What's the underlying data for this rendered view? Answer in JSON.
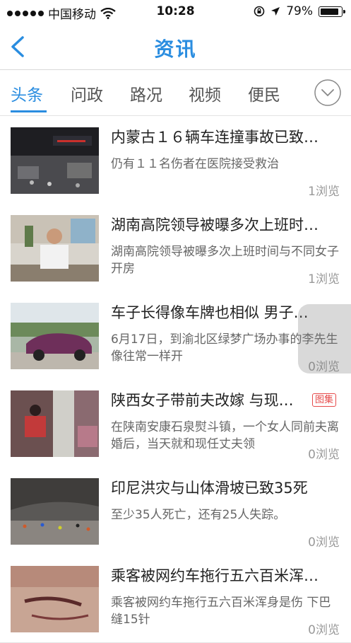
{
  "status": {
    "carrier": "中国移动",
    "time": "10:28",
    "battery": "79%"
  },
  "nav": {
    "title": "资讯"
  },
  "tabs": [
    "头条",
    "问政",
    "路况",
    "视频",
    "便民"
  ],
  "articles": [
    {
      "title": "内蒙古１６辆车连撞事故已致…",
      "summary": "仍有１１名伤者在医院接受救治",
      "views": "1浏览"
    },
    {
      "title": "湖南高院领导被曝多次上班时…",
      "summary": "湖南高院领导被曝多次上班时间与不同女子开房",
      "views": "1浏览"
    },
    {
      "title": "车子长得像车牌也相似 男子…",
      "summary": "6月17日，到渝北区绿梦广场办事的李先生像往常一样开",
      "views": "0浏览"
    },
    {
      "title": "陕西女子带前夫改嫁 与现…",
      "summary": "在陕南安康石泉熨斗镇，一个女人同前夫离婚后，当天就和现任丈夫领",
      "views": "0浏览",
      "tag": "图集"
    },
    {
      "title": "印尼洪灾与山体滑坡已致35死",
      "summary": "至少35人死亡，还有25人失踪。",
      "views": "0浏览"
    },
    {
      "title": "乘客被网约车拖行五六百米浑…",
      "summary": "乘客被网约车拖行五六百米浑身是伤 下巴缝15针",
      "views": "0浏览"
    }
  ],
  "colors": {
    "accent": "#2a8de0",
    "tag": "#e64a4a"
  }
}
